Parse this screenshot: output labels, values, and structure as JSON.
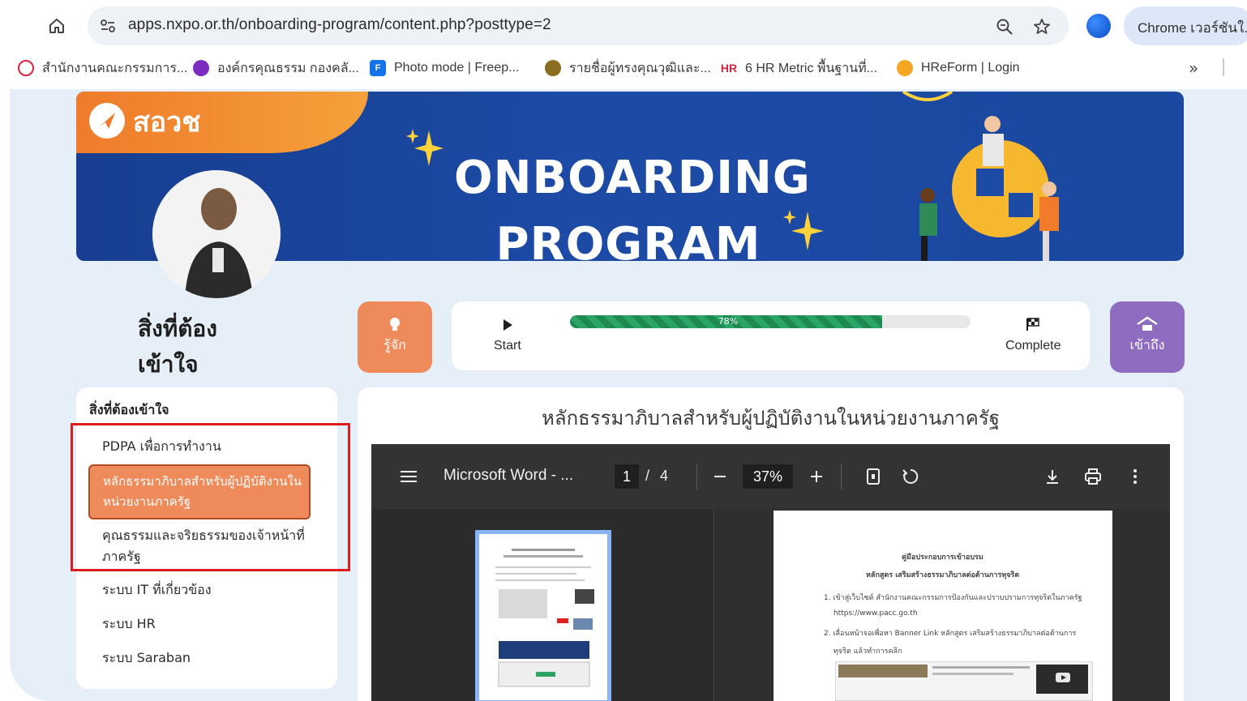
{
  "browser": {
    "url": "apps.nxpo.or.th/onboarding-program/content.php?posttype=2",
    "chrome_button_label": "Chrome เวอร์ชันใ...",
    "bookmarks": [
      {
        "label": "สำนักงานคณะกรรมการ...",
        "icon": "government-seal-icon"
      },
      {
        "label": "องค์กรคุณธรรม กองคลั...",
        "icon": "ethics-org-icon"
      },
      {
        "label": "Photo mode | Freep...",
        "icon": "freepik-icon"
      },
      {
        "label": "รายชื่อผู้ทรงคุณวุฒิและ...",
        "icon": "emblem-icon"
      },
      {
        "label": "6 HR Metric พื้นฐานที่...",
        "icon": "hr-logo-icon"
      },
      {
        "label": "HReForm | Login",
        "icon": "hreform-icon"
      }
    ]
  },
  "banner": {
    "logo_text": "สอวช",
    "title_line1": "ONBOARDING",
    "title_line2": "PROGRAM"
  },
  "profile": {
    "heading": "สิ่งที่ต้องเข้าใจ"
  },
  "progress": {
    "left_button": "รู้จัก",
    "start_label": "Start",
    "percent_label": "78%",
    "percent_value": 0.78,
    "complete_label": "Complete",
    "right_button": "เข้าถึง"
  },
  "sidebar": {
    "title": "สิ่งที่ต้องเข้าใจ",
    "items": [
      {
        "label": "PDPA เพื่อการทำงาน"
      },
      {
        "label": "หลักธรรมาภิบาลสำหรับผู้ปฏิบัติงานในหน่วยงานภาครัฐ",
        "active": true
      },
      {
        "label": "คุณธรรมและจริยธรรมของเจ้าหน้าที่ภาครัฐ"
      },
      {
        "label": "ระบบ IT ที่เกี่ยวข้อง"
      },
      {
        "label": "ระบบ HR"
      },
      {
        "label": "ระบบ Saraban"
      }
    ]
  },
  "content": {
    "title": "หลักธรรมาภิบาลสำหรับผู้ปฏิบัติงานในหน่วยงานภาครัฐ"
  },
  "pdf": {
    "doc_title": "Microsoft Word - ...",
    "page_current": "1",
    "page_separator": "/",
    "page_total": "4",
    "zoom": "37%",
    "doc_heading1": "คู่มือประกอบการเข้าอบรม",
    "doc_heading2": "หลักสูตร เสริมสร้างธรรมาภิบาลต่อต้านการทุจริต",
    "doc_item1": "1. เข้าสู่เว็บไซต์ สำนักงานคณะกรรมการป้องกันและปราบปรามการทุจริตในภาครัฐ",
    "doc_link": "https://www.pacc.go.th",
    "doc_item2": "2. เลื่อนหน้าจอเพื่อหา Banner Link หลักสูตร เสริมสร้างธรรมาภิบาลต่อต้านการ",
    "doc_item2b": "ทุจริต แล้วทำการคลิก"
  },
  "colors": {
    "accent_orange": "#ef8a5a",
    "accent_purple": "#8e6cbf",
    "progress_green": "#1e8a52",
    "banner_blue": "#1c4aa5",
    "highlight_red": "#e01b1b"
  }
}
